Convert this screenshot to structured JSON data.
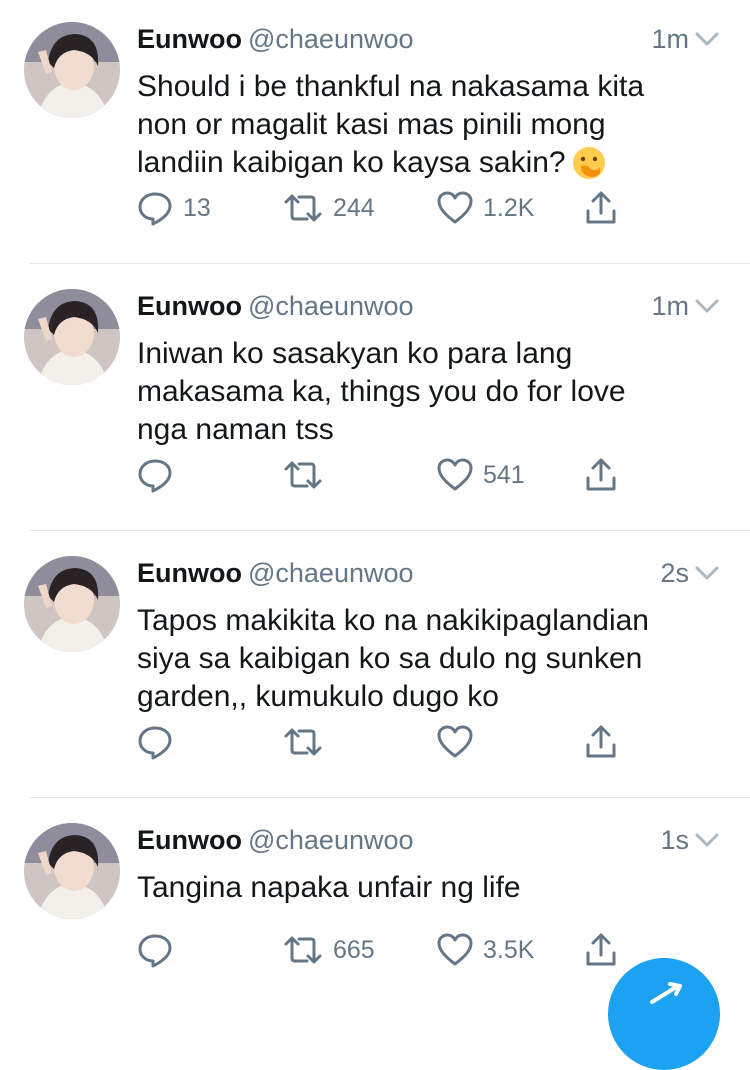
{
  "accent_color": "#1da1f2",
  "tweets": [
    {
      "name": "Eunwoo",
      "handle": "@chaeunwoo",
      "time": "1m",
      "text": "Should i be thankful na nakasama kita\nnon or magalit kasi mas pinili mong\nlandiin kaibigan ko kaysa sakin?",
      "emoji": "face-with-hand-over-mouth",
      "replies": "13",
      "retweets": "244",
      "likes": "1.2K"
    },
    {
      "name": "Eunwoo",
      "handle": "@chaeunwoo",
      "time": "1m",
      "text": "Iniwan ko sasakyan ko para lang\nmakasama ka, things you do for love\nnga naman tss",
      "replies": "",
      "retweets": "",
      "likes": "541"
    },
    {
      "name": "Eunwoo",
      "handle": "@chaeunwoo",
      "time": "2s",
      "text": "Tapos makikita ko na nakikipaglandian\nsiya sa kaibigan ko sa dulo ng sunken\ngarden,, kumukulo dugo ko",
      "replies": "",
      "retweets": "",
      "likes": ""
    },
    {
      "name": "Eunwoo",
      "handle": "@chaeunwoo",
      "time": "1s",
      "text": "Tangina napaka unfair ng life",
      "replies": "",
      "retweets": "665",
      "likes": "3.5K"
    }
  ],
  "icons": {
    "reply": "reply-icon",
    "retweet": "retweet-icon",
    "like": "heart-icon",
    "share": "share-icon",
    "more": "chevron-down-icon",
    "compose": "compose-tweet-icon"
  }
}
